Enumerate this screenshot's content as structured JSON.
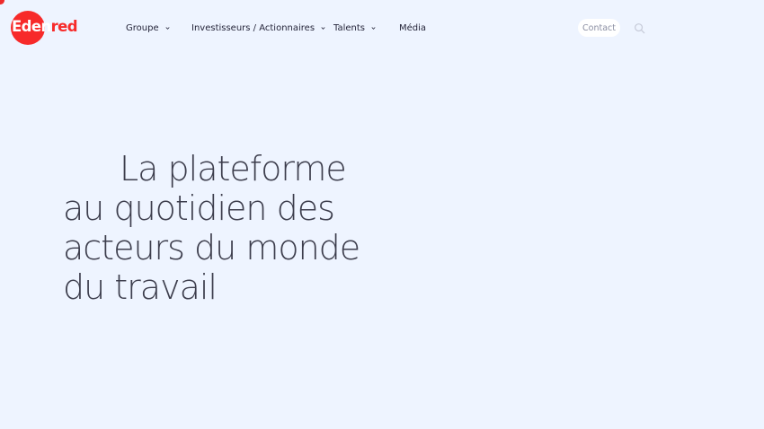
{
  "brand": {
    "name_part1": "Eden",
    "name_part2": "red",
    "color": "#f72a2a"
  },
  "nav": {
    "items": [
      {
        "label": "Groupe",
        "has_dropdown": true
      },
      {
        "label": "Investisseurs / Actionnaires",
        "has_dropdown": true
      },
      {
        "label": "Talents",
        "has_dropdown": true
      },
      {
        "label": "Média",
        "has_dropdown": false
      }
    ],
    "contact_label": "Contact",
    "search_icon": "search-icon"
  },
  "hero": {
    "lines": [
      "La plateforme",
      "au quotidien des",
      "acteurs du monde",
      "du travail"
    ]
  },
  "colors": {
    "background": "#eef4ff",
    "text": "#3c3d4c",
    "nav_text": "#25253a"
  }
}
